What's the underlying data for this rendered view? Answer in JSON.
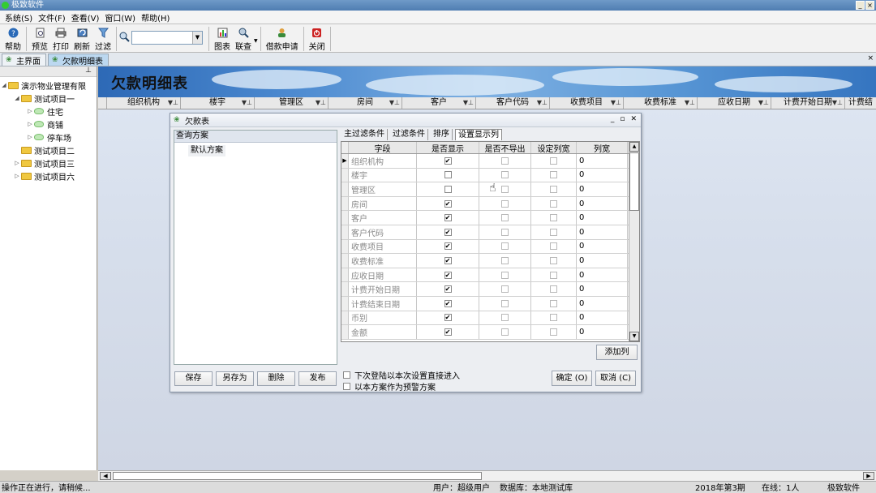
{
  "app": {
    "title": "极致软件"
  },
  "menu": [
    "系统(S)",
    "文件(F)",
    "查看(V)",
    "窗口(W)",
    "帮助(H)"
  ],
  "toolbar": {
    "help": "帮助",
    "preview": "预览",
    "print": "打印",
    "refresh": "刷新",
    "filter": "过滤",
    "chart": "图表",
    "link": "联查",
    "borrow": "借款申请",
    "close": "关闭",
    "search_value": ""
  },
  "tabs": [
    "主界面",
    "欠款明细表"
  ],
  "tree": {
    "root": "演示物业管理有限",
    "items": [
      "测试项目一",
      "住宅",
      "商铺",
      "停车场",
      "测试项目二",
      "测试项目三",
      "测试项目六"
    ]
  },
  "report": {
    "title": "欠款明细表",
    "columns": [
      "组织机构",
      "楼宇",
      "管理区",
      "房间",
      "客户",
      "客户代码",
      "收费项目",
      "收费标准",
      "应收日期",
      "计费开始日期",
      "计费结"
    ]
  },
  "dialog": {
    "title": "欠款表",
    "scheme_header": "查询方案",
    "scheme_item": "默认方案",
    "scheme_buttons": [
      "保存",
      "另存为",
      "删除",
      "发布"
    ],
    "tabs": [
      "主过滤条件",
      "过滤条件",
      "排序",
      "设置显示列"
    ],
    "grid_headers": [
      "字段",
      "是否显示",
      "是否不导出",
      "设定列宽",
      "列宽"
    ],
    "rows": [
      {
        "field": "组织机构",
        "show": true,
        "noexport": false,
        "setw": false,
        "width": "0"
      },
      {
        "field": "楼宇",
        "show": false,
        "noexport": false,
        "setw": false,
        "width": "0"
      },
      {
        "field": "管理区",
        "show": false,
        "noexport": false,
        "setw": false,
        "width": "0"
      },
      {
        "field": "房间",
        "show": true,
        "noexport": false,
        "setw": false,
        "width": "0"
      },
      {
        "field": "客户",
        "show": true,
        "noexport": false,
        "setw": false,
        "width": "0"
      },
      {
        "field": "客户代码",
        "show": true,
        "noexport": false,
        "setw": false,
        "width": "0"
      },
      {
        "field": "收费项目",
        "show": true,
        "noexport": false,
        "setw": false,
        "width": "0"
      },
      {
        "field": "收费标准",
        "show": true,
        "noexport": false,
        "setw": false,
        "width": "0"
      },
      {
        "field": "应收日期",
        "show": true,
        "noexport": false,
        "setw": false,
        "width": "0"
      },
      {
        "field": "计费开始日期",
        "show": true,
        "noexport": false,
        "setw": false,
        "width": "0"
      },
      {
        "field": "计费结束日期",
        "show": true,
        "noexport": false,
        "setw": false,
        "width": "0"
      },
      {
        "field": "币别",
        "show": true,
        "noexport": false,
        "setw": false,
        "width": "0"
      },
      {
        "field": "金额",
        "show": true,
        "noexport": false,
        "setw": false,
        "width": "0"
      }
    ],
    "add_column": "添加列",
    "opt1": "下次登陆以本次设置直接进入",
    "opt2": "以本方案作为预警方案",
    "ok": "确定 (O)",
    "cancel": "取消 (C)"
  },
  "status": {
    "left": "操作正在进行，请稍候...",
    "user": "用户：超级用户",
    "db": "数据库：本地测试库",
    "period": "2018年第3期",
    "online": "在线：1人",
    "brand": "极致软件"
  }
}
